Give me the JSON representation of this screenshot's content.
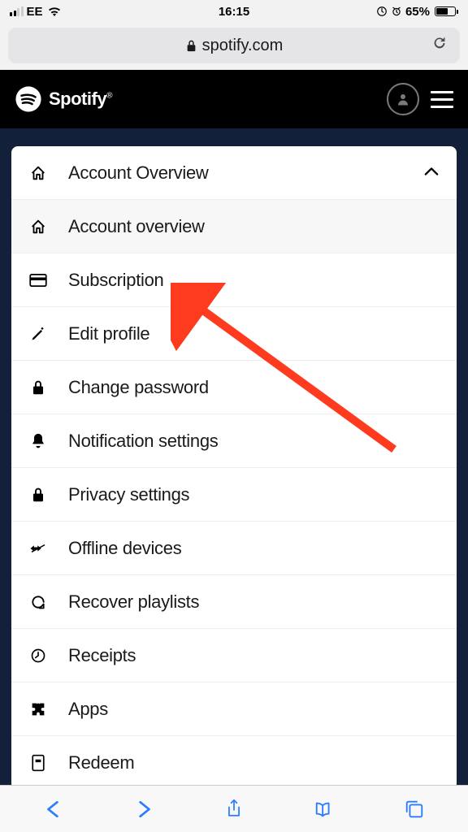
{
  "status": {
    "carrier": "EE",
    "time": "16:15",
    "battery_pct": "65%"
  },
  "browser": {
    "domain": "spotify.com"
  },
  "brand": {
    "name": "Spotify"
  },
  "menu": {
    "header": "Account Overview",
    "items": [
      {
        "label": "Account overview",
        "icon": "home",
        "selected": true
      },
      {
        "label": "Subscription",
        "icon": "card"
      },
      {
        "label": "Edit profile",
        "icon": "pen"
      },
      {
        "label": "Change password",
        "icon": "lock"
      },
      {
        "label": "Notification settings",
        "icon": "bell"
      },
      {
        "label": "Privacy settings",
        "icon": "lock"
      },
      {
        "label": "Offline devices",
        "icon": "offline"
      },
      {
        "label": "Recover playlists",
        "icon": "refresh"
      },
      {
        "label": "Receipts",
        "icon": "clock"
      },
      {
        "label": "Apps",
        "icon": "puzzle"
      },
      {
        "label": "Redeem",
        "icon": "redeem"
      }
    ]
  }
}
